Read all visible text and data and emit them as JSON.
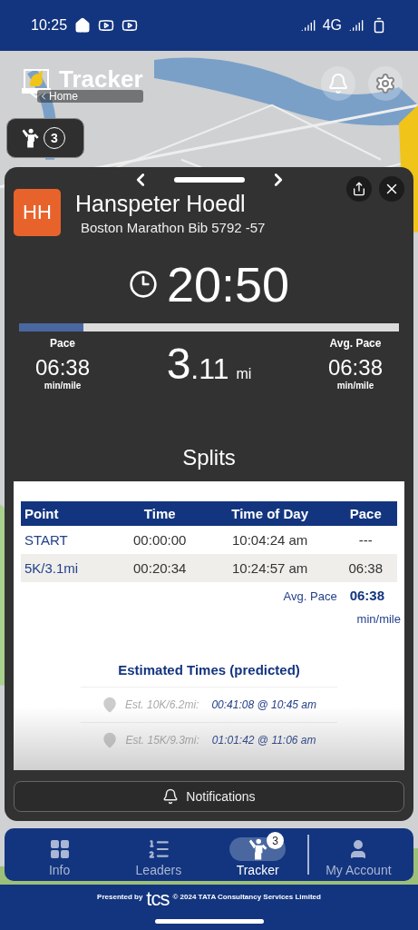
{
  "status_bar": {
    "time": "10:25",
    "network": "4G"
  },
  "header": {
    "title": "Tracker",
    "back_link": "Home"
  },
  "tracked_count": "3",
  "runner": {
    "initials": "HH",
    "name": "Hanspeter Hoedl",
    "subtitle": "Boston Marathon Bib 5792 -57",
    "elapsed": "20:50",
    "level": 0.17,
    "pace": {
      "label": "Pace",
      "value": "06:38",
      "unit": "min/mile"
    },
    "distance": {
      "whole": "3",
      "fraction": ".11",
      "unit": "mi"
    },
    "avg_pace": {
      "label": "Avg. Pace",
      "value": "06:38",
      "unit": "min/mile"
    }
  },
  "splits": {
    "title": "Splits",
    "columns": [
      "Point",
      "Time",
      "Time of Day",
      "Pace"
    ],
    "rows": [
      {
        "cells": [
          "START",
          "00:00:00",
          "10:04:24 am",
          "---"
        ]
      },
      {
        "cells": [
          "5K/3.1mi",
          "00:20:34",
          "10:24:57 am",
          "06:38"
        ]
      }
    ],
    "avg_label": "Avg. Pace",
    "avg_value": "06:38",
    "avg_unit": "min/mile"
  },
  "estimated": {
    "title": "Estimated Times (predicted)",
    "rows": [
      {
        "point": "Est. 10K/6.2mi:",
        "value": "00:41:08 @ 10:45 am"
      },
      {
        "point": "Est. 15K/9.3mi:",
        "value": "01:01:42 @ 11:06 am"
      }
    ]
  },
  "notifications_button": "Notifications",
  "nav": [
    {
      "label": "Info",
      "kind": "info",
      "selected": false
    },
    {
      "label": "Leaders",
      "kind": "leaders",
      "selected": false
    },
    {
      "label": "Tracker",
      "kind": "tracker",
      "selected": true,
      "badge": "3"
    },
    {
      "label": "My Account",
      "kind": "account",
      "selected": false
    }
  ],
  "footer": {
    "presented": "Presented by",
    "logo": "tcs",
    "copyright": "© 2024 TATA Consultancy Services Limited"
  }
}
